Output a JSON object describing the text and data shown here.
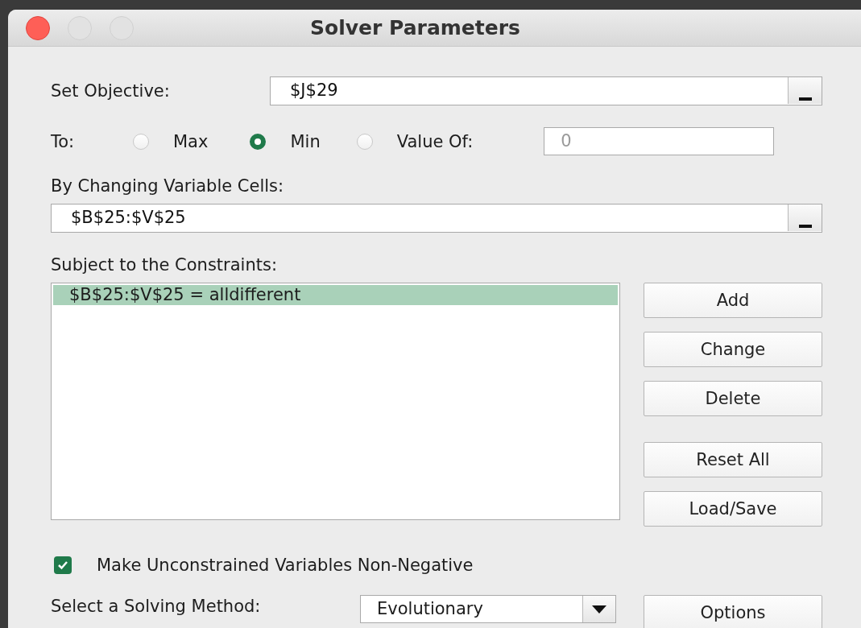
{
  "window": {
    "title": "Solver Parameters"
  },
  "objective": {
    "label": "Set Objective:",
    "value": "$J$29"
  },
  "to": {
    "label": "To:",
    "options": [
      {
        "label": "Max",
        "selected": false
      },
      {
        "label": "Min",
        "selected": true
      },
      {
        "label": "Value Of:",
        "selected": false
      }
    ],
    "value_of": {
      "value": "0",
      "disabled": true
    }
  },
  "variable_cells": {
    "label": "By Changing Variable Cells:",
    "value": "$B$25:$V$25"
  },
  "constraints": {
    "label": "Subject to the Constraints:",
    "items": [
      {
        "text": "$B$25:$V$25 = alldifferent",
        "selected": true
      }
    ]
  },
  "edit_buttons": [
    "Add",
    "Change",
    "Delete"
  ],
  "file_buttons": [
    "Reset All",
    "Load/Save"
  ],
  "non_negative": {
    "label": "Make Unconstrained Variables Non-Negative",
    "checked": true
  },
  "solving_method": {
    "label": "Select a Solving Method:",
    "value": "Evolutionary"
  },
  "options_button": "Options"
}
